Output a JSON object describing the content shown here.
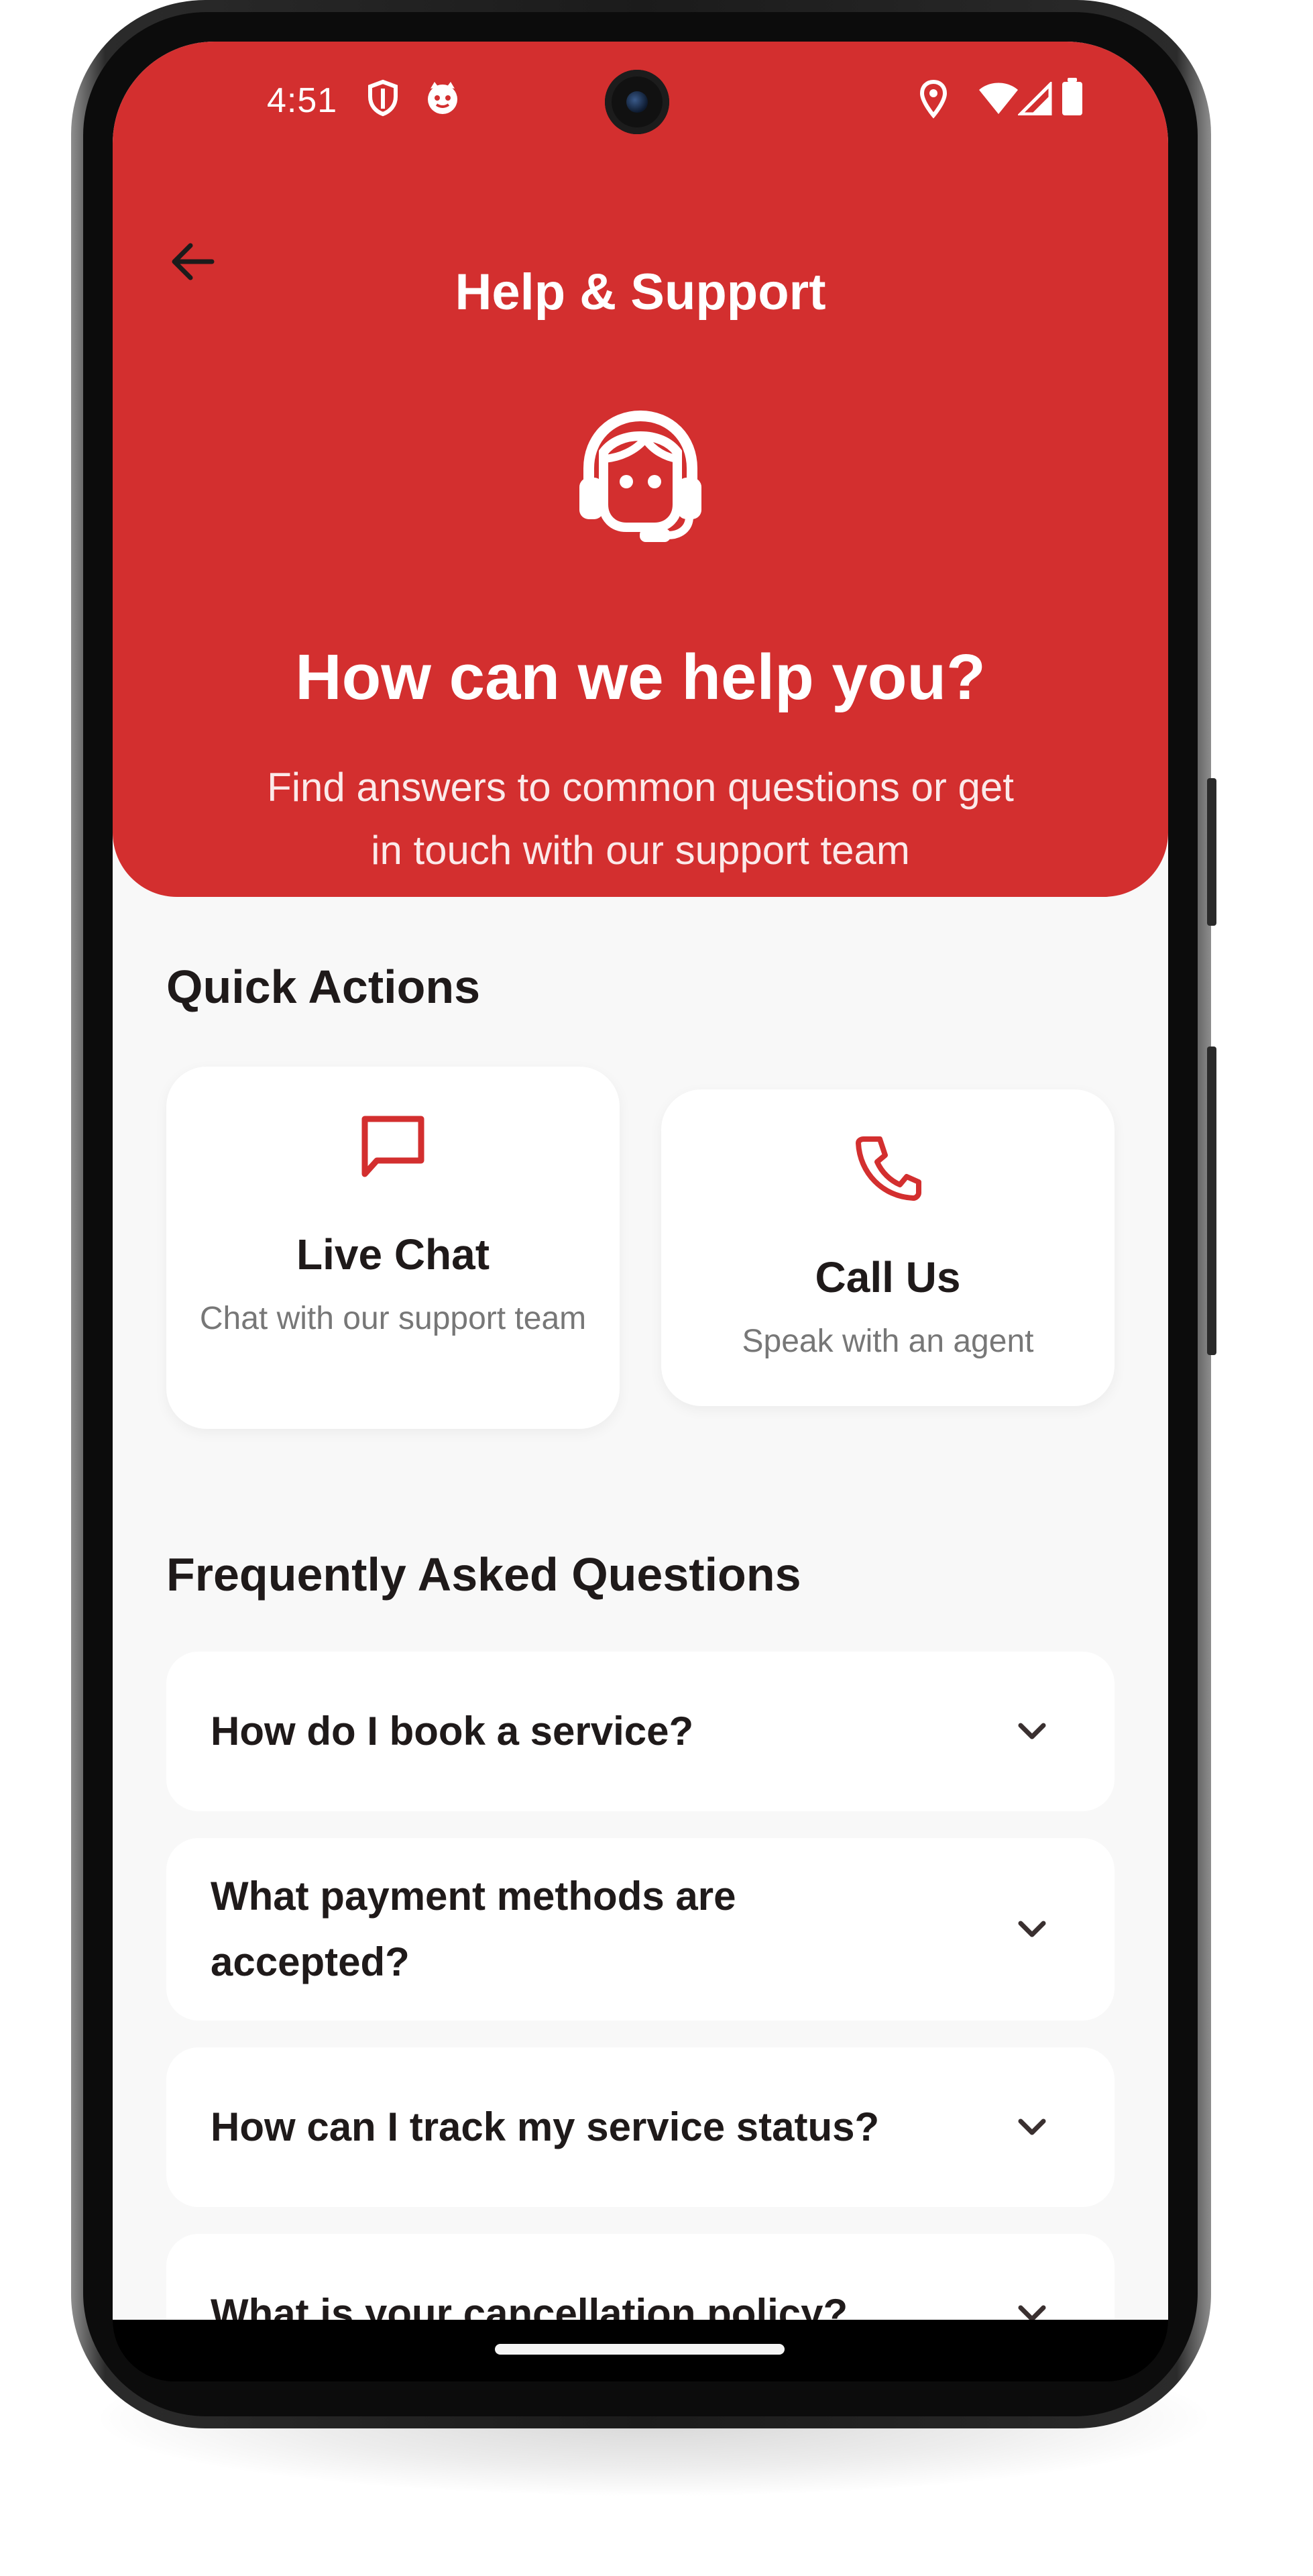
{
  "status_bar": {
    "time": "4:51"
  },
  "header": {
    "title": "Help & Support",
    "hero_title": "How can we help you?",
    "hero_subtitle": "Find answers to common questions or get in touch with our support team"
  },
  "quick_actions": {
    "heading": "Quick Actions",
    "items": [
      {
        "title": "Live Chat",
        "subtitle": "Chat with our support team",
        "icon": "chat-bubble-icon"
      },
      {
        "title": "Call Us",
        "subtitle": "Speak with an agent",
        "icon": "phone-icon"
      }
    ]
  },
  "faq": {
    "heading": "Frequently Asked Questions",
    "items": [
      {
        "question": "How do I book a service?"
      },
      {
        "question": "What payment methods are accepted?"
      },
      {
        "question": "How can I track my service status?"
      },
      {
        "question": "What is your cancellation policy?"
      }
    ]
  },
  "colors": {
    "brand": "#d32f2f",
    "background": "#f8f8f8",
    "card": "#ffffff",
    "text_primary": "#1f1a1a",
    "text_secondary": "#777777"
  }
}
